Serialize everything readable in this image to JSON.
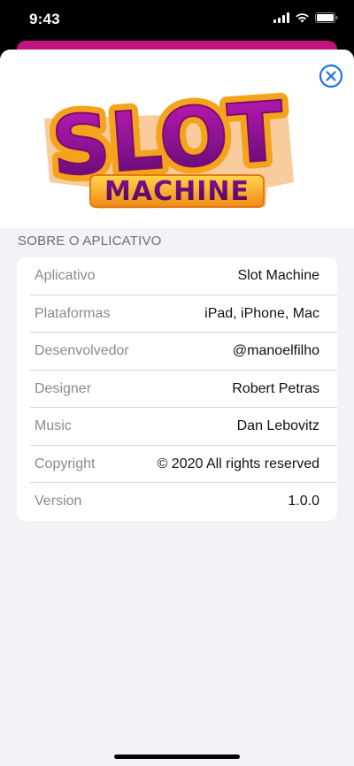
{
  "status_bar": {
    "time": "9:43"
  },
  "icons": {
    "signal": "cellular-signal-icon",
    "wifi": "wifi-icon",
    "battery": "battery-icon",
    "close": "close-circle-icon"
  },
  "colors": {
    "accent": "#1a73e8",
    "behind_bar": "#c2127e",
    "background": "#f2f2f7"
  },
  "logo": {
    "line1": "SLOT",
    "line2": "MACHINE"
  },
  "section": {
    "title": "SOBRE O APLICATIVO"
  },
  "rows": [
    {
      "label": "Aplicativo",
      "value": "Slot Machine"
    },
    {
      "label": "Plataformas",
      "value": "iPad, iPhone, Mac"
    },
    {
      "label": "Desenvolvedor",
      "value": "@manoelfilho"
    },
    {
      "label": "Designer",
      "value": "Robert Petras"
    },
    {
      "label": "Music",
      "value": "Dan Lebovitz"
    },
    {
      "label": "Copyright",
      "value": "© 2020 All rights reserved"
    },
    {
      "label": "Version",
      "value": "1.0.0"
    }
  ]
}
